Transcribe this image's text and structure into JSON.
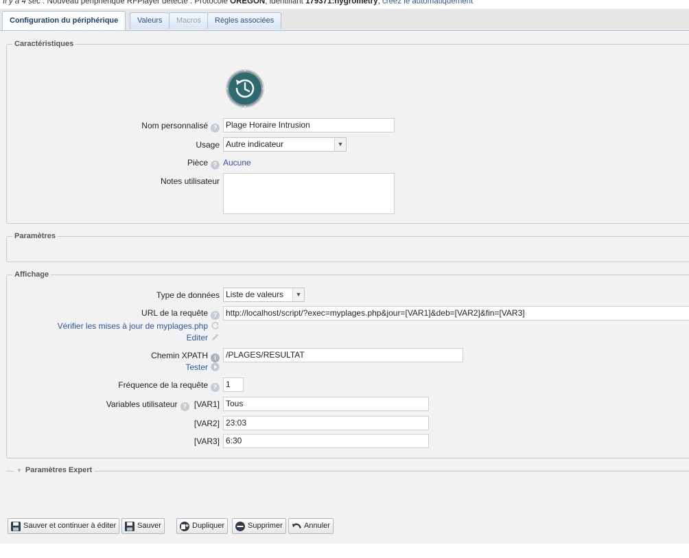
{
  "notice": {
    "time": "Il y a 4 sec",
    "text1": " : Nouveau périphérique RFPlayer détecté : Protocole ",
    "protocol": "OREGON",
    "text2": ", identifiant ",
    "identifier": "179371:hygrometry",
    "text3": ", ",
    "link": "créez le automatiquement"
  },
  "tabs": [
    {
      "label": "Configuration du périphérique",
      "state": "active"
    },
    {
      "label": "Valeurs",
      "state": "normal"
    },
    {
      "label": "Macros",
      "state": "disabled"
    },
    {
      "label": "Règles associées",
      "state": "normal"
    }
  ],
  "characteristics": {
    "legend": "Caractéristiques",
    "icon": "clock-history-icon",
    "name_label": "Nom personnalisé",
    "name_value": "Plage Horaire Intrusion",
    "usage_label": "Usage",
    "usage_value": "Autre indicateur",
    "room_label": "Pièce",
    "room_value": "Aucune",
    "notes_label": "Notes utilisateur",
    "notes_value": ""
  },
  "parameters": {
    "legend": "Paramètres"
  },
  "display": {
    "legend": "Affichage",
    "type_label": "Type de données",
    "type_value": "Liste de valeurs",
    "url_label": "URL de la requête",
    "url_value": "http://localhost/script/?exec=myplages.php&jour=[VAR1]&deb=[VAR2]&fin=[VAR3]",
    "check_updates": "Vérifier les mises à jour de myplages.php",
    "edit": "Editer",
    "xpath_label": "Chemin XPATH",
    "xpath_value": "/PLAGES/RESULTAT",
    "test": "Tester",
    "freq_label": "Fréquence de la requête",
    "freq_value": "1",
    "vars_label": "Variables utilisateur",
    "vars": [
      {
        "name": "[VAR1]",
        "value": "Tous"
      },
      {
        "name": "[VAR2]",
        "value": "23:03"
      },
      {
        "name": "[VAR3]",
        "value": "6:30"
      }
    ]
  },
  "expert": {
    "legend": "Paramètres Expert"
  },
  "buttons": {
    "save_continue": "Sauver et continuer à éditer",
    "save": "Sauver",
    "duplicate": "Dupliquer",
    "delete": "Supprimer",
    "cancel": "Annuler"
  }
}
